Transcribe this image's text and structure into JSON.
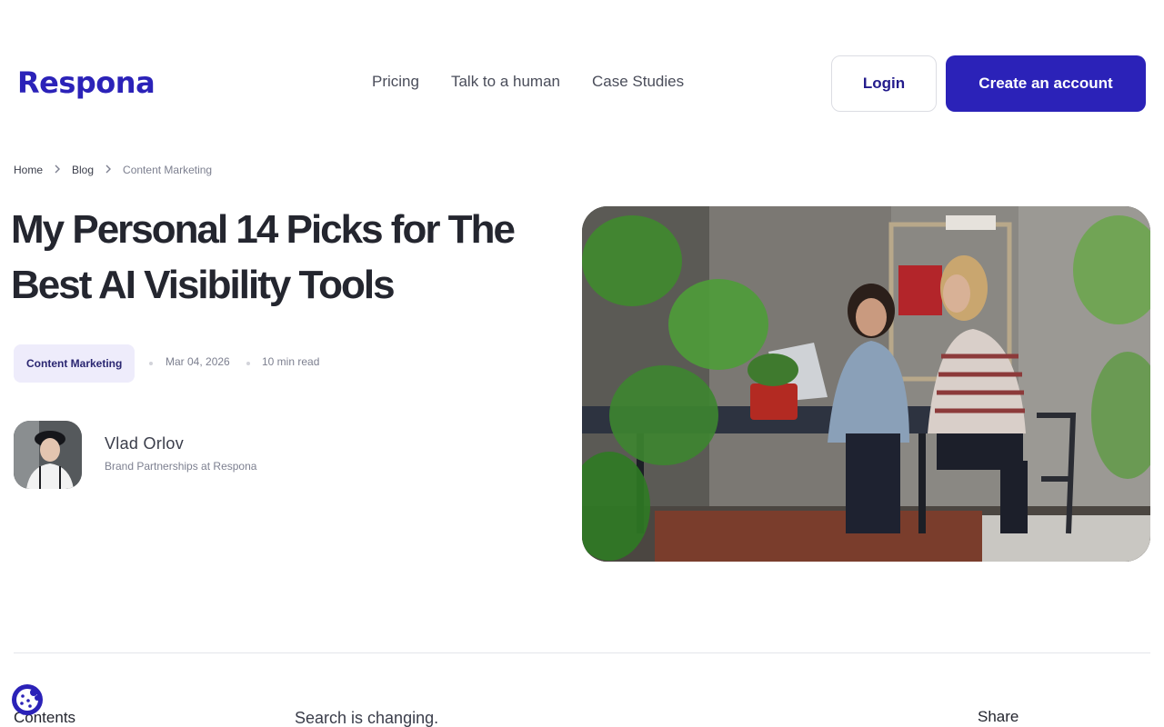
{
  "header": {
    "logo": "Respona",
    "nav": [
      "Pricing",
      "Talk to a human",
      "Case Studies"
    ],
    "login_label": "Login",
    "create_label": "Create an account"
  },
  "breadcrumb": [
    "Home",
    "Blog",
    "Content Marketing"
  ],
  "article": {
    "title": "My Personal 14 Picks for The Best AI Visibility Tools",
    "category": "Content Marketing",
    "date": "Mar 04, 2026",
    "read_time": "10 min read",
    "author_name": "Vlad Orlov",
    "author_role": "Brand Partnerships at Respona",
    "intro": "Search is changing."
  },
  "sidebar": {
    "contents_label": "Contents",
    "share_label": "Share"
  },
  "colors": {
    "brand": "#2b22b8",
    "tag_bg": "#eeecfb"
  },
  "icons": [
    "chevron-right-icon",
    "cookie-icon"
  ]
}
